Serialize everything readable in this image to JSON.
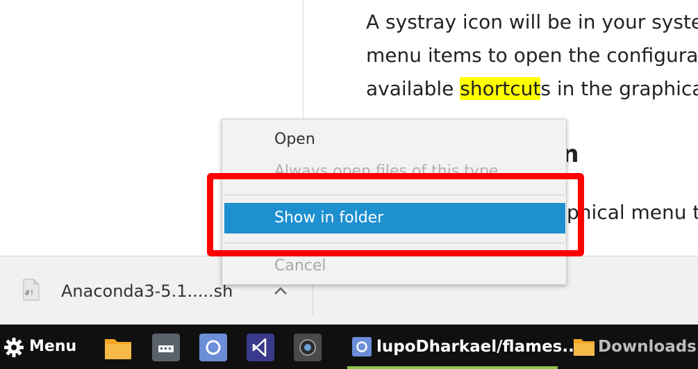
{
  "article": {
    "line1": "A systray icon will be in your system tray",
    "line2": "menu items to open the configuration",
    "line3_before": "available ",
    "line3_highlight": "shortcut",
    "line3_after": "s in the graphical",
    "heading_fragment": "on",
    "para2_fragment": "phical menu to"
  },
  "download_shelf": {
    "file_icon": "shell-script-file-icon",
    "file_name": "Anaconda3-5.1.....sh",
    "chevron_icon": "chevron-up-icon"
  },
  "context_menu": {
    "open": "Open",
    "always_open": "Always open files of this type",
    "show_in_folder": "Show in folder",
    "cancel": "Cancel"
  },
  "taskbar": {
    "menu_label": "Menu",
    "menu_icon": "gear-icon",
    "launchers": [
      "files-icon",
      "terminal-icon",
      "chromium-icon",
      "vscode-icon",
      "camera-icon"
    ],
    "task_browser_label": "lupoDharkael/flames...",
    "task_files_label": "Downloads"
  },
  "colors": {
    "highlight": "#ffff00",
    "menu_selected": "#1e90d0",
    "annotation": "#ff0000",
    "taskbar": "#101010",
    "active_task_underline": "#8bc34a"
  }
}
